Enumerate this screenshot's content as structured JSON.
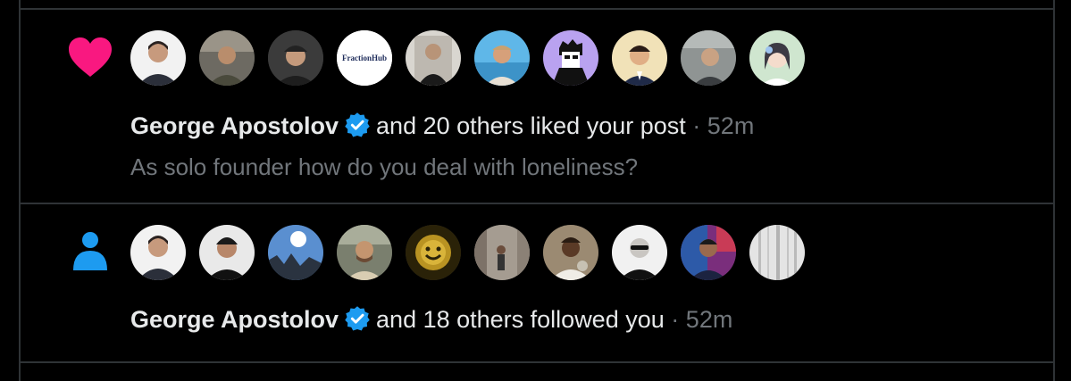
{
  "colors": {
    "background": "#000000",
    "border": "#2f3336",
    "text_primary": "#e7e9ea",
    "text_secondary": "#71767b",
    "like_heart": "#f91880",
    "follow_person": "#1d9bf0",
    "verified_badge": "#1d9bf0"
  },
  "notifications": [
    {
      "type_icon": "heart-icon",
      "avatars": [
        "avatar-man-dark-hair-white-background",
        "avatar-man-city-background",
        "avatar-man-cap",
        "avatar-fractionhub-logo",
        "avatar-man-mirror-selfie",
        "avatar-man-beach",
        "avatar-illustrated-character-purple",
        "avatar-cartoon-man-suit",
        "avatar-man-outdoor-gray",
        "avatar-anime-girl-flowers"
      ],
      "fraction_logo_text": "FractionHub",
      "user_name": "George Apostolov",
      "verified_icon": "verified-badge-icon",
      "action_text": "and 20 others liked your post",
      "separator": "·",
      "time": "52m",
      "post_text": "As solo founder how do you deal with loneliness?"
    },
    {
      "type_icon": "person-icon",
      "avatars": [
        "avatar-man-dark-hair-white-background",
        "avatar-man-smiling-black-shirt",
        "avatar-sky-sun-trees",
        "avatar-man-outdoor-beard",
        "avatar-golden-smiley-face",
        "avatar-person-street",
        "avatar-man-holding-cup",
        "avatar-bald-man-sunglasses",
        "avatar-man-colorful-background",
        "avatar-foggy-forest"
      ],
      "user_name": "George Apostolov",
      "verified_icon": "verified-badge-icon",
      "action_text": "and 18 others followed you",
      "separator": "·",
      "time": "52m"
    }
  ]
}
